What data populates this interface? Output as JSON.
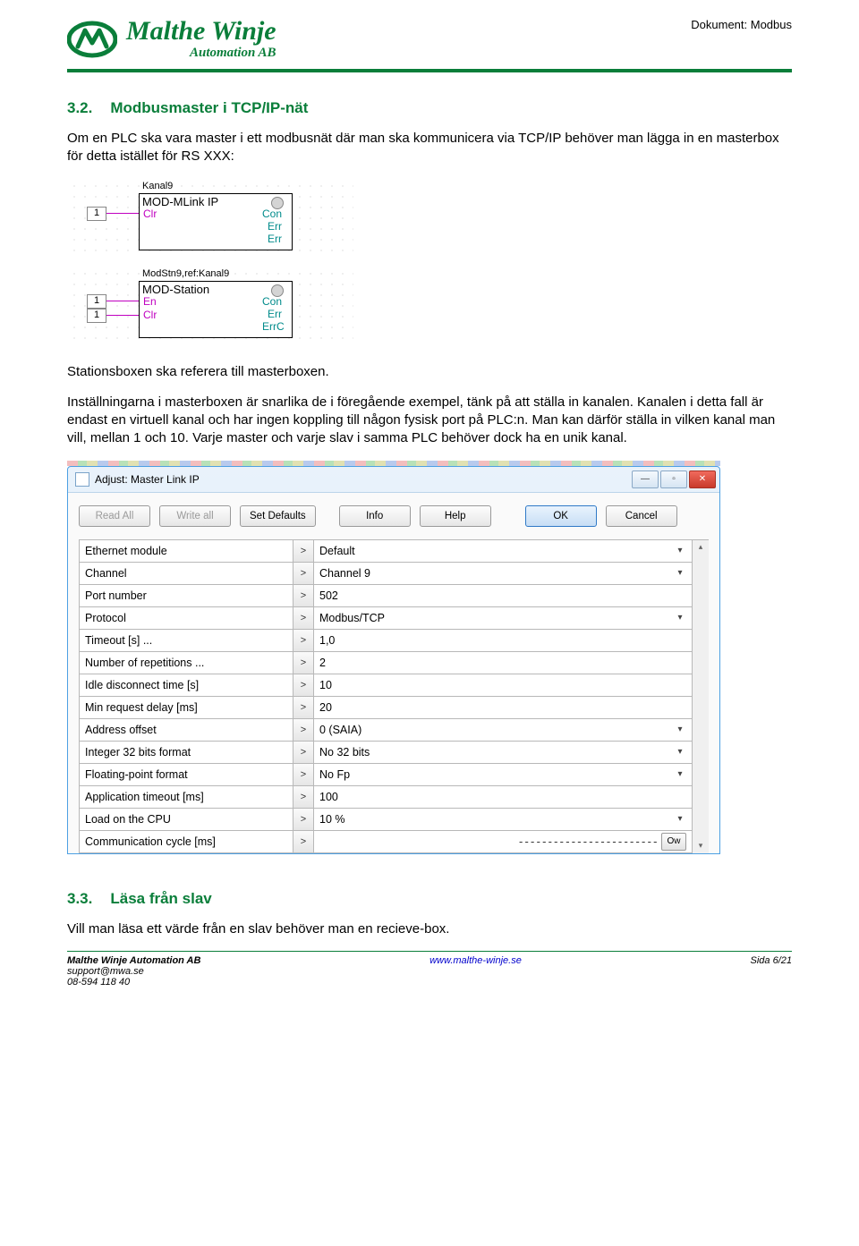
{
  "header": {
    "logo_line1": "Malthe Winje",
    "logo_line2": "Automation AB",
    "doc_label": "Dokument: Modbus"
  },
  "section32": {
    "num": "3.2.",
    "title": "Modbusmaster i TCP/IP-nät",
    "intro": "Om en PLC ska vara master i ett modbusnät där man ska kommunicera via TCP/IP behöver man lägga in en masterbox för detta istället för RS XXX:"
  },
  "diagram": {
    "block1": {
      "name": "Kanal9",
      "type": "MOD-MLink IP",
      "in": [
        "Clr"
      ],
      "out": [
        "Con",
        "Err",
        "Err"
      ],
      "input_vals": [
        "1"
      ]
    },
    "block2": {
      "name": "ModStn9,ref:Kanal9",
      "type": "MOD-Station",
      "in": [
        "En",
        "Clr"
      ],
      "out": [
        "Con",
        "Err",
        "ErrC"
      ],
      "input_vals": [
        "1",
        "1"
      ]
    }
  },
  "para2": "Stationsboxen ska referera till masterboxen.",
  "para3": "Inställningarna i masterboxen är snarlika de i föregående exempel, tänk på att ställa in kanalen. Kanalen i detta fall är endast en virtuell kanal och har ingen koppling till någon fysisk port på PLC:n. Man kan därför ställa in vilken kanal man vill, mellan 1 och 10. Varje master och varje slav i samma PLC behöver dock ha en unik kanal.",
  "dialog": {
    "title": "Adjust: Master Link IP",
    "toolbar": {
      "read_all": "Read All",
      "write_all": "Write all",
      "set_defaults": "Set Defaults",
      "info": "Info",
      "help": "Help",
      "ok": "OK",
      "cancel": "Cancel"
    },
    "rows": [
      {
        "label": "Ethernet module",
        "value": "Default",
        "combo": true
      },
      {
        "label": "Channel",
        "value": "Channel 9",
        "combo": true
      },
      {
        "label": "Port number",
        "value": "502",
        "combo": false
      },
      {
        "label": "Protocol",
        "value": "Modbus/TCP",
        "combo": true
      },
      {
        "label": "Timeout [s] ...",
        "value": "1,0",
        "combo": false
      },
      {
        "label": "Number of repetitions ...",
        "value": "2",
        "combo": false
      },
      {
        "label": "Idle disconnect time [s]",
        "value": "10",
        "combo": false
      },
      {
        "label": "Min request delay [ms]",
        "value": "20",
        "combo": false
      },
      {
        "label": "Address offset",
        "value": "0 (SAIA)",
        "combo": true
      },
      {
        "label": "Integer 32 bits format",
        "value": "No 32 bits",
        "combo": true
      },
      {
        "label": "Floating-point format",
        "value": "No Fp",
        "combo": true
      },
      {
        "label": "Application timeout [ms]",
        "value": "100",
        "combo": false
      },
      {
        "label": "Load on the CPU",
        "value": "10 %",
        "combo": true
      },
      {
        "label": "Communication cycle [ms]",
        "value": "",
        "combo": false,
        "extra": "dashes"
      }
    ],
    "dashes": "------------------------",
    "ow": "Ow"
  },
  "section33": {
    "num": "3.3.",
    "title": "Läsa från slav",
    "para": "Vill man läsa ett värde från en slav behöver man en recieve-box."
  },
  "footer": {
    "company": "Malthe Winje Automation AB",
    "email": "support@mwa.se",
    "phone": "08-594 118 40",
    "url": "www.malthe-winje.se",
    "page": "Sida 6/21"
  }
}
